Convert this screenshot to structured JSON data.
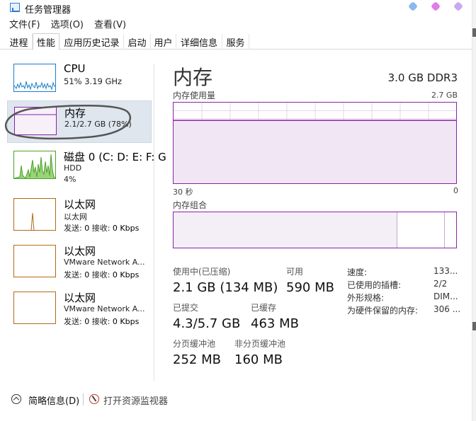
{
  "window": {
    "title": "任务管理器"
  },
  "menu": [
    "文件(F)",
    "选项(O)",
    "查看(V)"
  ],
  "tabs": [
    "进程",
    "性能",
    "应用历史记录",
    "启动",
    "用户",
    "详细信息",
    "服务"
  ],
  "active_tab_index": 1,
  "sidebar": {
    "items": [
      {
        "title": "CPU",
        "sub": "51% 3.19 GHz",
        "color": "#1a7fc8"
      },
      {
        "title": "内存",
        "sub": "2.1/2.7 GB (78%)",
        "color": "#8b22a8",
        "selected": true
      },
      {
        "title": "磁盘 0 (C: D: E: F: G",
        "sub": "HDD",
        "sub2": "4%",
        "color": "#4ca32a"
      },
      {
        "title": "以太网",
        "sub": "以太网",
        "send_label": "发送: ",
        "send": "0",
        "recv_label": " 接收: ",
        "recv": "0 Kbps",
        "color": "#b06a1a"
      },
      {
        "title": "以太网",
        "sub": "VMware Network A...",
        "send_label": "发送: ",
        "send": "0",
        "recv_label": " 接收: ",
        "recv": "0 Kbps",
        "color": "#b06a1a"
      },
      {
        "title": "以太网",
        "sub": "VMware Network A...",
        "send_label": "发送: ",
        "send": "0",
        "recv_label": " 接收: ",
        "recv": "0 Kbps",
        "color": "#b06a1a"
      }
    ]
  },
  "main": {
    "title": "内存",
    "spec": "3.0 GB DDR3",
    "usage_label": "内存使用量",
    "usage_max": "2.7 GB",
    "time_left": "30 秒",
    "time_right": "0",
    "compose_label": "内存组合",
    "usage_level": 0.78
  },
  "stats": {
    "in_use_label": "使用中(已压缩)",
    "in_use": "2.1 GB (134 MB)",
    "available_label": "可用",
    "available": "590 MB",
    "committed_label": "已提交",
    "committed": "4.3/5.7 GB",
    "cached_label": "已缓存",
    "cached": "463 MB",
    "paged_label": "分页缓冲池",
    "paged": "252 MB",
    "nonpaged_label": "非分页缓冲池",
    "nonpaged": "160 MB"
  },
  "info": [
    {
      "label": "速度:",
      "value": "133..."
    },
    {
      "label": "已使用的插槽:",
      "value": "2/2"
    },
    {
      "label": "外形规格:",
      "value": "DIM..."
    },
    {
      "label": "为硬件保留的内存:",
      "value": "306 ..."
    }
  ],
  "footer": {
    "less_details": "简略信息(D)",
    "resource_monitor": "打开资源监视器"
  },
  "colors": {
    "memory_accent": "#8b22a8",
    "cpu_accent": "#1a7fc8",
    "disk_accent": "#4ca32a",
    "net_accent": "#b06a1a",
    "pen_blue": "#8ab8f0",
    "pen_pink": "#e07de8",
    "pen_purple": "#c9a8f0"
  }
}
